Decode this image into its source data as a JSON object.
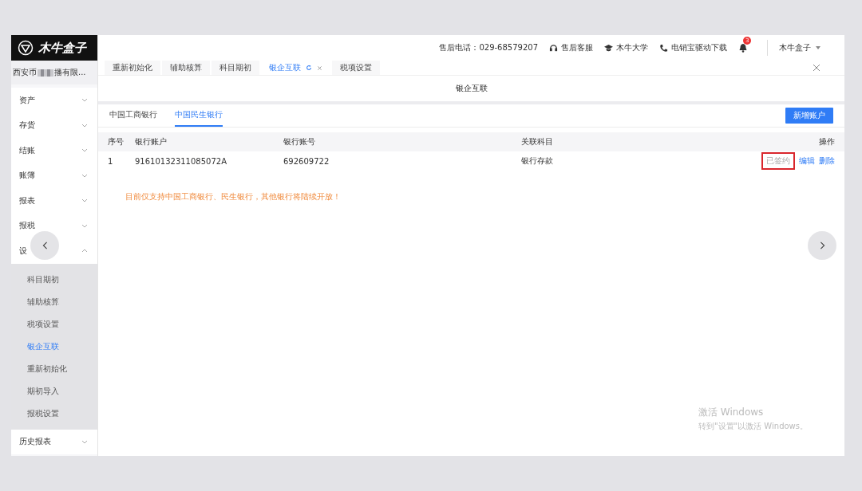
{
  "logo": {
    "text": "木牛盒子"
  },
  "company": {
    "parts": [
      "西安币",
      "播有限..."
    ]
  },
  "sidebar": {
    "items": [
      {
        "label": "资产",
        "expanded": false
      },
      {
        "label": "存货",
        "expanded": false
      },
      {
        "label": "结账",
        "expanded": false
      },
      {
        "label": "账簿",
        "expanded": false
      },
      {
        "label": "报表",
        "expanded": false
      },
      {
        "label": "报税",
        "expanded": false
      },
      {
        "label": "设",
        "expanded": true,
        "children": [
          {
            "label": "科目期初",
            "selected": false
          },
          {
            "label": "辅助核算",
            "selected": false
          },
          {
            "label": "税项设置",
            "selected": false
          },
          {
            "label": "银企互联",
            "selected": true
          },
          {
            "label": "重新初始化",
            "selected": false
          },
          {
            "label": "期初导入",
            "selected": false
          },
          {
            "label": "报税设置",
            "selected": false
          }
        ]
      },
      {
        "label": "历史报表",
        "expanded": false
      }
    ]
  },
  "header": {
    "hotline": "售后电话：029-68579207",
    "links": [
      "售后客服",
      "木牛大学",
      "电销宝驱动下载"
    ],
    "notification_count": "3",
    "user": "木牛盒子"
  },
  "open_tabs": [
    {
      "label": "重新初始化",
      "selected": false
    },
    {
      "label": "辅助核算",
      "selected": false
    },
    {
      "label": "科目期初",
      "selected": false
    },
    {
      "label": "银企互联",
      "selected": true
    },
    {
      "label": "税项设置",
      "selected": false
    }
  ],
  "page_title": "银企互联",
  "bank_tabs": [
    {
      "label": "中国工商银行",
      "selected": false
    },
    {
      "label": "中国民生银行",
      "selected": true
    }
  ],
  "new_button": "新增账户",
  "table": {
    "columns": [
      "序号",
      "银行账户",
      "银行账号",
      "关联科目",
      "操作"
    ],
    "rows": [
      {
        "index": "1",
        "account_name": "9161013231108507​2A",
        "account_no": "692609722",
        "subject": "银行存款",
        "status": "已签约",
        "status_highlighted": true,
        "actions": [
          "编辑",
          "删除"
        ]
      }
    ]
  },
  "notice": "目前仅支持中国工商银行、民生银行，其他银行将陆续开放！",
  "watermark": {
    "title": "激活 Windows",
    "hint": "转到\"设置\"以激活 Windows。"
  }
}
